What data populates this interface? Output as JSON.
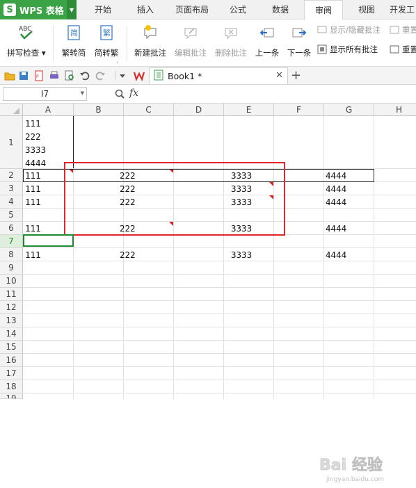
{
  "app": {
    "name": "WPS 表格",
    "logo_letter": "S",
    "brand_color": "#3aa345"
  },
  "menu": {
    "tabs": [
      "开始",
      "插入",
      "页面布局",
      "公式",
      "数据",
      "审阅",
      "视图",
      "开发工"
    ],
    "active_tab": "审阅"
  },
  "ribbon": {
    "spellcheck": "拼写检查",
    "trad_to_simp": "繁转简",
    "simp_to_trad": "简转繁",
    "trad_char": "简",
    "simp_char": "繁",
    "new_comment": "新建批注",
    "edit_comment": "编辑批注",
    "delete_comment": "删除批注",
    "prev": "上一条",
    "next": "下一条",
    "show_hide_comment": "显示/隐藏批注",
    "show_all_comments": "显示所有批注",
    "reset_top": "重置",
    "reset_bottom": "重置"
  },
  "doc_tab": {
    "name": "Book1 *"
  },
  "formula_bar": {
    "name_box": "I7",
    "fx": "fx"
  },
  "sheet": {
    "columns": [
      "A",
      "B",
      "C",
      "D",
      "E",
      "F",
      "G",
      "H"
    ],
    "rows": [
      "1",
      "2",
      "3",
      "4",
      "5",
      "6",
      "7",
      "8",
      "9",
      "10",
      "11",
      "12",
      "13",
      "14",
      "15",
      "16",
      "17",
      "18",
      "19"
    ],
    "active_row": "7",
    "row1_a": "111\n222\n3333\n4444",
    "data_rows": [
      {
        "row": "2",
        "a": "111",
        "c": "222",
        "e": "3333",
        "g": "4444"
      },
      {
        "row": "3",
        "a": "111",
        "c": "222",
        "e": "3333",
        "g": "4444"
      },
      {
        "row": "4",
        "a": "111",
        "c": "222",
        "e": "3333",
        "g": "4444"
      },
      {
        "row": "6",
        "a": "111",
        "c": "222",
        "e": "3333",
        "g": "4444"
      },
      {
        "row": "8",
        "a": "111",
        "c": "222",
        "e": "3333",
        "g": "4444"
      }
    ]
  },
  "watermark": {
    "text": "Bai 经验",
    "url": "jingyan.baidu.com"
  }
}
